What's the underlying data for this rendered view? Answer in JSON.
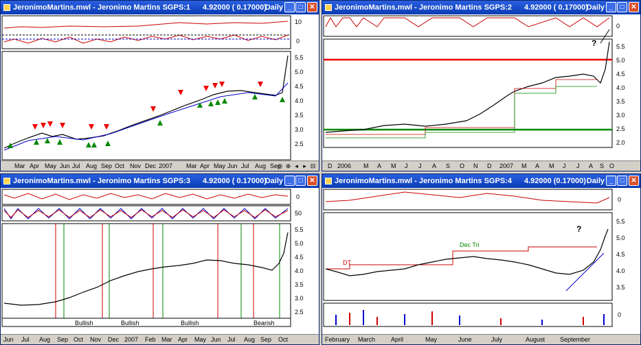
{
  "windows": [
    {
      "title": "JeronimoMartins.mwl - Jeronimo Martins SGPS:1",
      "price": "4.92000 ( 0.17000)",
      "period": "Daily",
      "months": [
        "Mar",
        "Apr",
        "May",
        "Jun",
        "Jul",
        "Aug",
        "Sep",
        "Oct",
        "Nov",
        "Dec",
        "2007",
        "Mar",
        "Apr",
        "May",
        "Jun",
        "Jul",
        "Aug",
        "Sep"
      ],
      "axis_top": [
        "10",
        "0"
      ],
      "axis_main": [
        "5.5",
        "5.0",
        "4.5",
        "4.0",
        "3.5",
        "3.0",
        "2.5"
      ]
    },
    {
      "title": "JeronimoMartins.mwl - Jeronimo Martins SGPS:2",
      "price": "4.92000 ( 0.17000)",
      "period": "Daily",
      "months": [
        "D",
        "2006",
        "M",
        "A",
        "M",
        "J",
        "J",
        "A",
        "S",
        "O",
        "N",
        "D",
        "2007",
        "M",
        "A",
        "M",
        "J",
        "J",
        "A",
        "S",
        "O"
      ],
      "axis_top": [
        "0"
      ],
      "axis_main": [
        "5.5",
        "5.0",
        "4.5",
        "4.0",
        "3.5",
        "3.0",
        "2.5",
        "2.0"
      ],
      "annotation": "?"
    },
    {
      "title": "JeronimoMartins.mwl - Jeronimo Martins SGPS:3",
      "price": "4.92000 ( 0.17000)",
      "period": "Daily",
      "months": [
        "Jun",
        "Jul",
        "Aug",
        "Sep",
        "Oct",
        "Nov",
        "Dec",
        "2007",
        "Feb",
        "Mar",
        "Apr",
        "May",
        "Jun",
        "Jul",
        "Aug",
        "Sep",
        "Oct"
      ],
      "axis_top": [
        "0"
      ],
      "axis_mid": [
        "50"
      ],
      "axis_main": [
        "5.5",
        "5.0",
        "4.5",
        "4.0",
        "3.5",
        "3.0",
        "2.5"
      ],
      "bands": [
        "Bullish",
        "Bullish",
        "Bullish",
        "Bearish"
      ]
    },
    {
      "title": "JeronimoMartins.mwl - Jeronimo Martins SGPS:4",
      "price": "4.92000 (0.17000)",
      "period": "Daily",
      "months": [
        "February",
        "March",
        "April",
        "May",
        "June",
        "July",
        "August",
        "September"
      ],
      "axis_top": [
        "0"
      ],
      "axis_main": [
        "5.5",
        "5.0",
        "4.5",
        "4.0",
        "3.5"
      ],
      "axis_bottom": [
        "0"
      ],
      "labels": [
        "DT",
        "Dec Tri",
        "?"
      ]
    }
  ],
  "nav_glyphs": [
    "‡",
    "Ò",
    "‡",
    "‡",
    "◎",
    "⊕",
    "◂",
    "▸",
    "⊟"
  ]
}
